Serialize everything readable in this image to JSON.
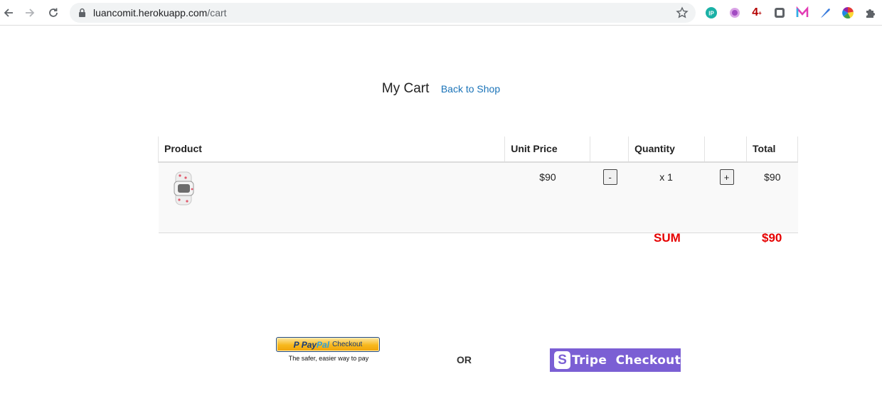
{
  "browser": {
    "url_host": "luancomit.herokuapp.com",
    "url_path": "/cart"
  },
  "page": {
    "title": "My Cart",
    "back_link": "Back to Shop"
  },
  "table": {
    "headers": {
      "product": "Product",
      "unit_price": "Unit Price",
      "quantity": "Quantity",
      "total": "Total"
    },
    "rows": [
      {
        "product_image": "smartwatch-band-thumbnail",
        "unit_price": "$90",
        "decrement": "-",
        "quantity": "x 1",
        "increment": "+",
        "total": "$90"
      }
    ]
  },
  "summary": {
    "label": "SUM",
    "value": "$90",
    "color": "#e60000"
  },
  "checkout": {
    "paypal_p": "P",
    "paypal_pay": "Pay",
    "paypal_pal": "Pal",
    "paypal_checkout": "Checkout",
    "paypal_tagline": "The safer, easier way to pay",
    "or_label": "OR",
    "stripe_s": "S",
    "stripe_label": "Tripe  Checkout",
    "stripe_color": "#7b5fd4"
  },
  "extensions": [
    "ip-icon",
    "purple-circle-icon",
    "four-icon",
    "square-icon",
    "m-icon",
    "feather-icon",
    "color-wheel-icon",
    "puzzle-icon"
  ]
}
